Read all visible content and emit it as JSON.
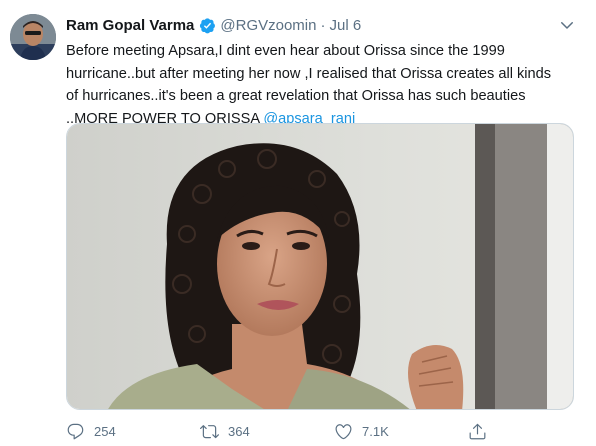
{
  "tweet": {
    "author_name": "Ram Gopal Varma",
    "handle": "@RGVzoomin",
    "separator": "·",
    "date": "Jul 6",
    "text_lines": [
      "Before meeting Apsara,I dint even hear about Orissa since the 1999",
      "hurricane..but after meeting her now ,I realised that Orissa creates all kinds",
      "of hurricanes..it's been a great revelation that Orissa has such beauties"
    ],
    "last_line_text": "..MORE POWER TO ORISSA ",
    "mention": "@apsara_rani_",
    "media_alt": "photo",
    "actions": {
      "reply_count": "254",
      "retweet_count": "364",
      "like_count": "7.1K"
    },
    "icons": {
      "verified": "verified-badge-icon",
      "caret": "chevron-down-icon",
      "reply": "reply-icon",
      "retweet": "retweet-icon",
      "like": "heart-icon",
      "share": "share-icon"
    },
    "colors": {
      "link": "#1b95e0",
      "muted": "#5b7083",
      "verified": "#1da1f2"
    }
  }
}
